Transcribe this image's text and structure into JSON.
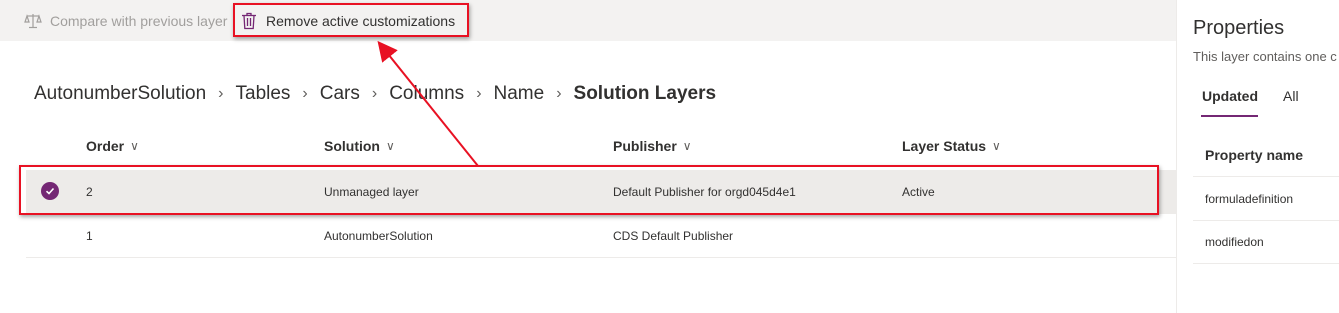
{
  "toolbar": {
    "compare_label": "Compare with previous layer",
    "remove_label": "Remove active customizations"
  },
  "breadcrumb": {
    "items": [
      "AutonumberSolution",
      "Tables",
      "Cars",
      "Columns",
      "Name"
    ],
    "current": "Solution Layers"
  },
  "table": {
    "columns": [
      "Order",
      "Solution",
      "Publisher",
      "Layer Status"
    ],
    "rows": [
      {
        "order": "2",
        "solution": "Unmanaged layer",
        "publisher": "Default Publisher for orgd045d4e1",
        "status": "Active",
        "selected": true
      },
      {
        "order": "1",
        "solution": "AutonumberSolution",
        "publisher": "CDS Default Publisher",
        "status": "",
        "selected": false
      }
    ]
  },
  "properties_panel": {
    "title": "Properties",
    "subtitle": "This layer contains one c",
    "tabs": [
      "Updated",
      "All"
    ],
    "active_tab": "Updated",
    "column_header": "Property name",
    "items": [
      "formuladefinition",
      "modifiedon"
    ]
  },
  "colors": {
    "accent": "#742774",
    "highlight": "#e81123",
    "toolbar_bg": "#f3f2f1"
  },
  "icons": [
    "scale-icon",
    "trash-icon",
    "chevron-right-icon",
    "chevron-down-icon",
    "check-circle-icon"
  ]
}
